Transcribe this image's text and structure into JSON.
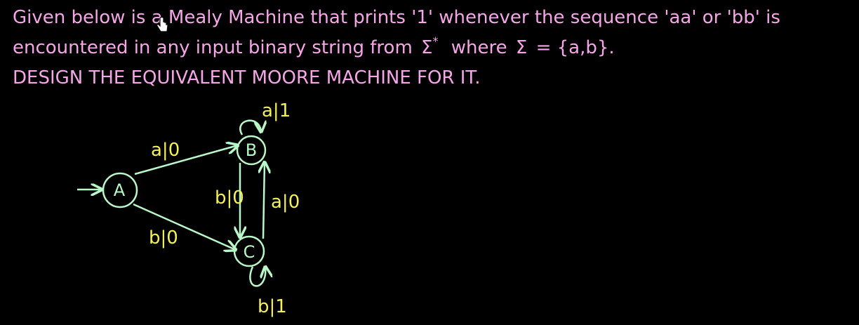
{
  "problem": {
    "line1": "Given below is a Mealy Machine that prints '1' whenever the sequence 'aa' or 'bb' is",
    "line2_pre": "encountered in any input binary string from",
    "sigma": "Σ",
    "star": "*",
    "line2_mid": "where",
    "line2_post": "= {a,b}.",
    "line3": "DESIGN THE EQUIVALENT MOORE MACHINE FOR IT."
  },
  "colors": {
    "text": "#f4a6e6",
    "edge": "#b9f7c9",
    "label": "#f3f05a",
    "background": "#000000"
  },
  "states": {
    "A": "A",
    "B": "B",
    "C": "C"
  },
  "transitions": {
    "A_B": "a|0",
    "A_C": "b|0",
    "B_C": "b|0",
    "C_B": "a|0",
    "B_B": "a|1",
    "C_C": "b|1"
  },
  "icons": {
    "cursor": "hand-pointer-icon"
  }
}
